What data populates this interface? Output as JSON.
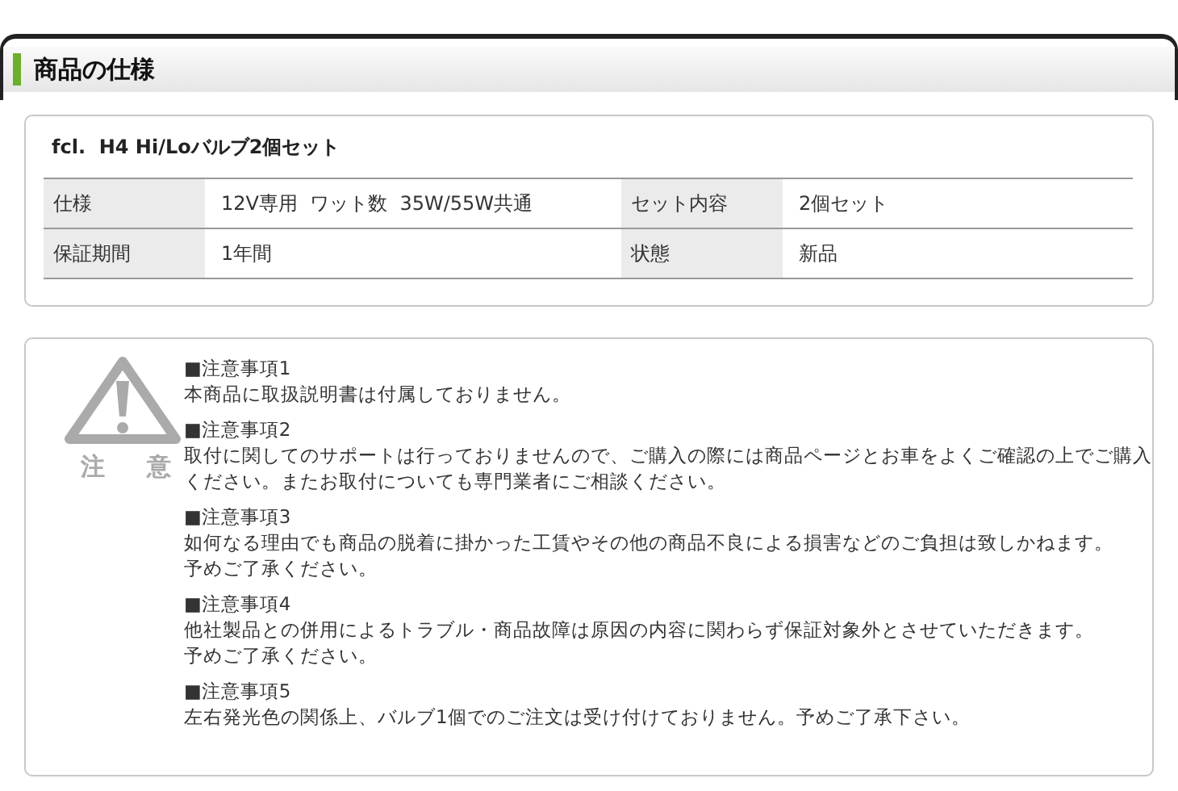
{
  "section_title": "商品の仕様",
  "product": {
    "name": "fcl.  H4 Hi/Loバルブ2個セット",
    "rows": [
      [
        {
          "label": "仕様",
          "value": "12V専用  ワット数  35W/55W共通"
        },
        {
          "label": "セット内容",
          "value": "2個セット"
        }
      ],
      [
        {
          "label": "保証期間",
          "value": "1年間"
        },
        {
          "label": "状態",
          "value": "新品"
        }
      ]
    ]
  },
  "notice": {
    "icon_label": [
      "注",
      "意"
    ],
    "items": [
      {
        "title": "■注意事項1",
        "lines": [
          "本商品に取扱説明書は付属しておりません。"
        ]
      },
      {
        "title": "■注意事項2",
        "lines": [
          "取付に関してのサポートは行っておりませんので、ご購入の際には商品ページとお車をよくご確認の上でご購入",
          "ください。またお取付についても専門業者にご相談ください。"
        ]
      },
      {
        "title": "■注意事項3",
        "lines": [
          "如何なる理由でも商品の脱着に掛かった工賃やその他の商品不良による損害などのご負担は致しかねます。",
          "予めご了承ください。"
        ]
      },
      {
        "title": "■注意事項4",
        "lines": [
          "他社製品との併用によるトラブル・商品故障は原因の内容に関わらず保証対象外とさせていただきます。",
          "予めご了承ください。"
        ]
      },
      {
        "title": "■注意事項5",
        "lines": [
          "左右発光色の関係上、バルブ1個でのご注文は受け付けておりません。予めご了承下さい。"
        ]
      }
    ]
  }
}
